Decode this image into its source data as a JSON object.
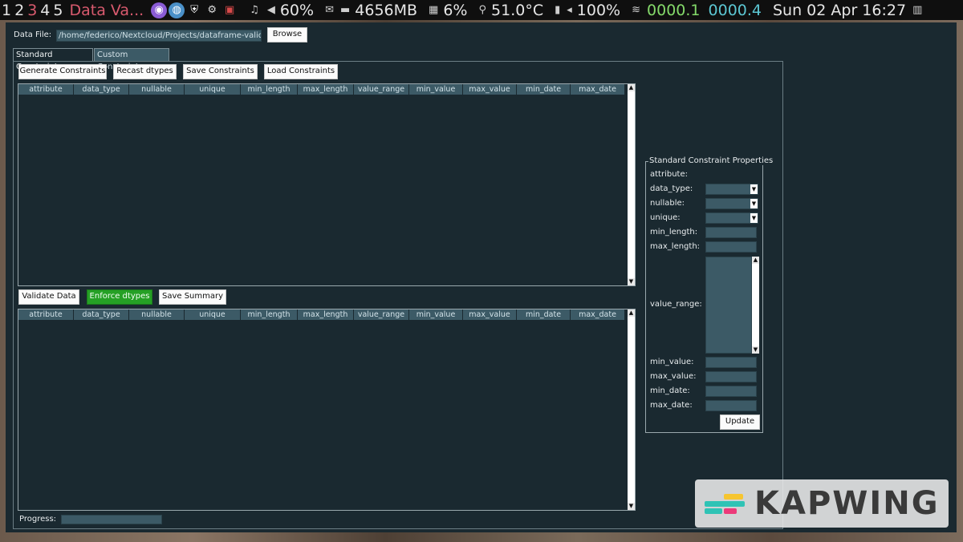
{
  "topbar": {
    "workspaces": [
      "1",
      "2",
      "3",
      "4",
      "5"
    ],
    "active_workspace": "3",
    "window_title": "Data Va...",
    "volume": "60%",
    "memory": "4656MB",
    "cpu": "6%",
    "temperature": "51.0°C",
    "battery": "100%",
    "net_down": "0000.1",
    "net_up": "0000.4",
    "clock": "Sun 02 Apr 16:27",
    "colors": {
      "title": "#d85a6e",
      "net_down": "#84d96a",
      "net_up": "#5cc7d3"
    }
  },
  "file": {
    "label": "Data File:",
    "path": "/home/federico/Nextcloud/Projects/dataframe-validation/te",
    "browse_label": "Browse"
  },
  "tabs": [
    "Standard Constraints",
    "Custom Constraints"
  ],
  "toolbar_top": {
    "generate": "Generate Constraints",
    "recast": "Recast dtypes",
    "save": "Save Constraints",
    "load": "Load Constraints"
  },
  "columns": [
    "attribute",
    "data_type",
    "nullable",
    "unique",
    "min_length",
    "max_length",
    "value_range",
    "min_value",
    "max_value",
    "min_date",
    "max_date"
  ],
  "toolbar_bottom": {
    "validate": "Validate Data",
    "enforce": "Enforce dtypes",
    "save_summary": "Save Summary"
  },
  "properties": {
    "title": "Standard Constraint Properties",
    "attribute": "attribute:",
    "data_type": "data_type:",
    "nullable": "nullable:",
    "unique": "unique:",
    "min_length": "min_length:",
    "max_length": "max_length:",
    "value_range": "value_range:",
    "min_value": "min_value:",
    "max_value": "max_value:",
    "min_date": "min_date:",
    "max_date": "max_date:",
    "update": "Update"
  },
  "progress": {
    "label": "Progress:",
    "fraction": 0
  },
  "watermark": "KAPWING",
  "colors": {
    "background": "#1a2930",
    "field": "#3c5a66",
    "enforce_button": "#25a025"
  }
}
